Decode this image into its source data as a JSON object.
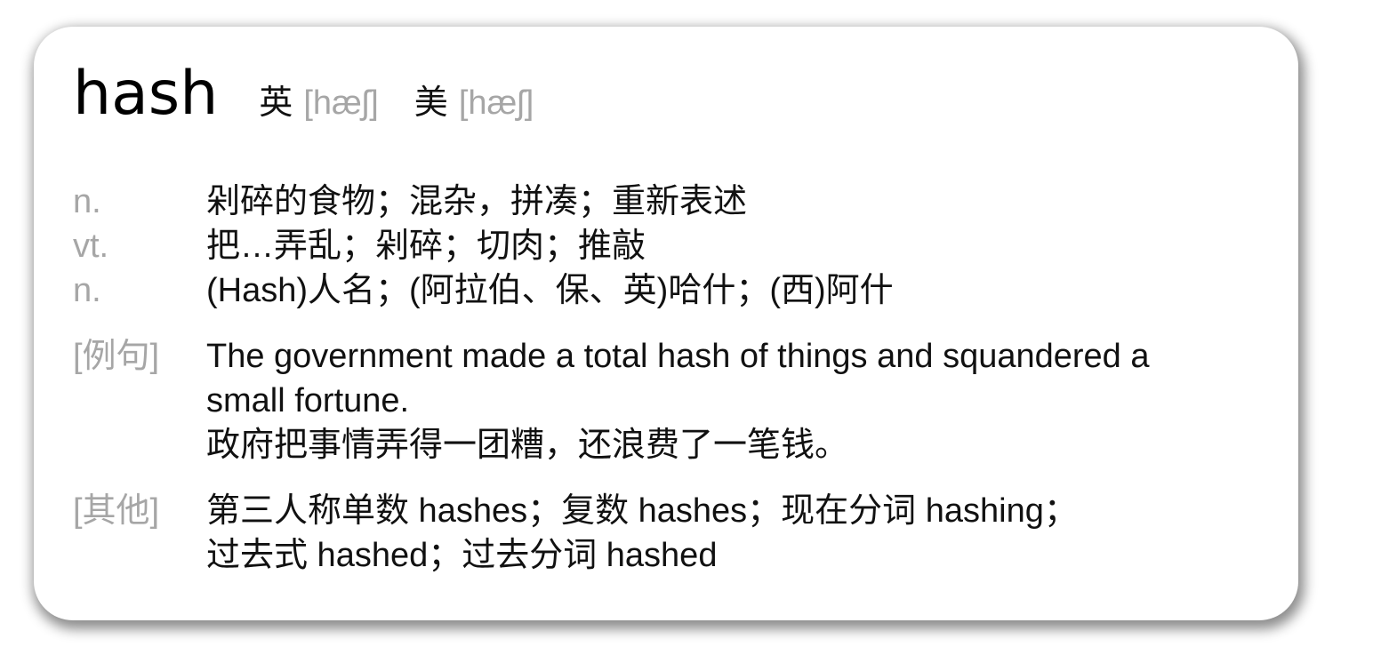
{
  "entry": {
    "word": "hash",
    "pronunciations": [
      {
        "label": "英",
        "ipa": "[hæʃ]"
      },
      {
        "label": "美",
        "ipa": "[hæʃ]"
      }
    ],
    "definitions": [
      {
        "pos": "n.",
        "text": "剁碎的食物；混杂，拼凑；重新表述"
      },
      {
        "pos": "vt.",
        "text": "把…弄乱；剁碎；切肉；推敲"
      },
      {
        "pos": "n.",
        "text": "(Hash)人名；(阿拉伯、保、英)哈什；(西)阿什"
      }
    ],
    "example": {
      "label": "[例句]",
      "en_line1": "The government made a total hash of things and squandered a",
      "en_line2": "small fortune.",
      "zh": "政府把事情弄得一团糟，还浪费了一笔钱。"
    },
    "other": {
      "label": "[其他]",
      "line1": "第三人称单数 hashes；复数 hashes；现在分词 hashing；",
      "line2": "过去式 hashed；过去分词 hashed"
    }
  }
}
